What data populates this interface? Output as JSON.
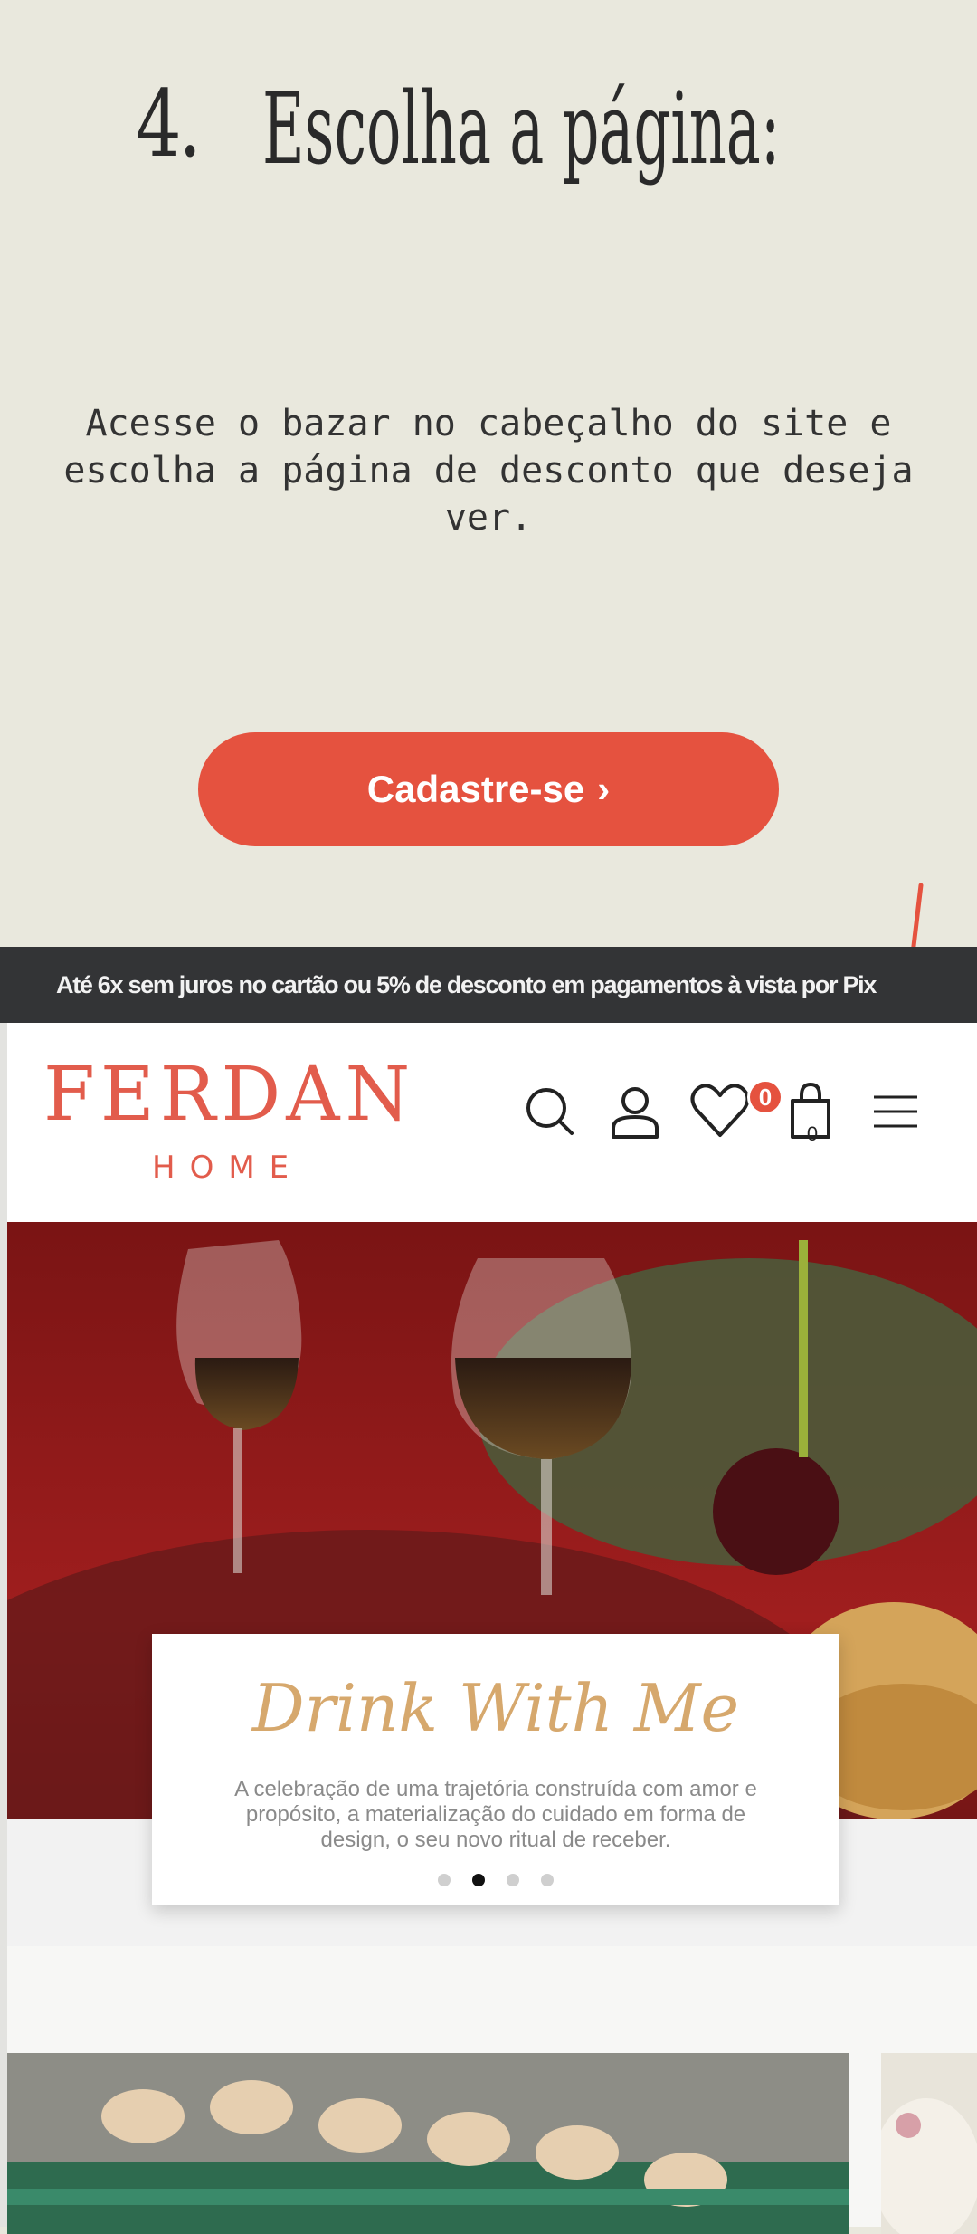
{
  "step": {
    "number": "4.",
    "title": "Escolha a página:"
  },
  "description": "Acesse o bazar no cabeçalho do site e escolha a página de desconto que deseja ver.",
  "cta": {
    "label": "Cadastre-se",
    "chevron": "›"
  },
  "screenshot": {
    "promo_bar": "Até 6x sem juros no cartão ou 5% de desconto em pagamentos à vista por Pix",
    "logo": {
      "main": "FERDAN",
      "sub": "HOME"
    },
    "header_icons": [
      "search-icon",
      "user-icon",
      "heart-icon",
      "bag-icon",
      "menu-icon"
    ],
    "wishlist_count": "0",
    "cart_count": "0",
    "hero": {
      "heading": "Drink With Me",
      "text": "A celebração de uma trajetória construída com amor e propósito, a materialização do cuidado em forma de design, o seu novo ritual de receber.",
      "dots": 4,
      "active_dot": 2
    }
  },
  "colors": {
    "accent": "#e5523f",
    "background": "#e9e8dd",
    "logo": "#e25c4c",
    "promo_bg": "#333436"
  }
}
